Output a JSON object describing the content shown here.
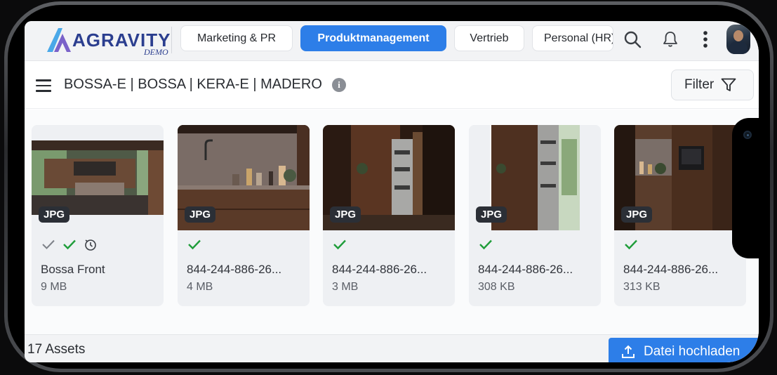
{
  "app": {
    "logo_text": "AGRAVITY",
    "logo_sub": "DEMO"
  },
  "tabs": [
    {
      "label": "Marketing & PR",
      "active": false
    },
    {
      "label": "Produktmanagement",
      "active": true
    },
    {
      "label": "Vertrieb",
      "active": false
    },
    {
      "label": "Personal (HR)",
      "active": false
    }
  ],
  "header_icons": [
    "search-icon",
    "bell-icon",
    "more-vertical-icon",
    "avatar"
  ],
  "collection": {
    "breadcrumb": "BOSSA-E | BOSSA | KERA-E | MADERO",
    "filter_label": "Filter"
  },
  "assets": [
    {
      "badge": "JPG",
      "name": "Bossa Front",
      "size": "9 MB",
      "status": [
        "check-gray-icon",
        "check-green-icon",
        "history-icon"
      ]
    },
    {
      "badge": "JPG",
      "name": "844-244-886-26...",
      "size": "4 MB",
      "status": [
        "check-green-icon"
      ]
    },
    {
      "badge": "JPG",
      "name": "844-244-886-26...",
      "size": "3 MB",
      "status": [
        "check-green-icon"
      ]
    },
    {
      "badge": "JPG",
      "name": "844-244-886-26...",
      "size": "308 KB",
      "status": [
        "check-green-icon"
      ]
    },
    {
      "badge": "JPG",
      "name": "844-244-886-26...",
      "size": "313 KB",
      "status": [
        "check-green-icon"
      ]
    }
  ],
  "footer": {
    "assets_count": "17 Assets",
    "upload_label": "Datei hochladen"
  },
  "colors": {
    "accent": "#2d7ee8",
    "brand": "#2b3e8f",
    "check_green": "#1f9d3a"
  }
}
